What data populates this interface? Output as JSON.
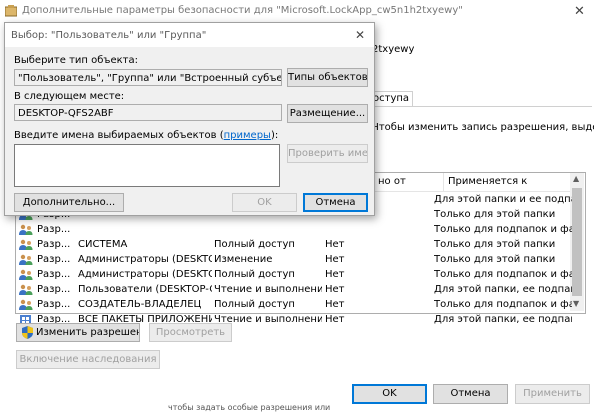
{
  "outer": {
    "title": "Дополнительные параметры безопасности  для \"Microsoft.LockApp_cw5n1h2txyewy\"",
    "bg_name_fragment": "2txyewy",
    "tab_fragment": "оступа",
    "instruction": "Чтобы изменить запись разрешения, выделите",
    "columns": {
      "inherited": "но от",
      "applies": "Применяется к"
    },
    "rows": [
      {
        "type": "Разр...",
        "principal": "",
        "access": "",
        "inherited": "",
        "applies": "Для этой папки и ее подпап..."
      },
      {
        "type": "Разр...",
        "principal": "",
        "access": "",
        "inherited": "",
        "applies": "Только для этой папки"
      },
      {
        "type": "Разр...",
        "principal": "",
        "access": "",
        "inherited": "",
        "applies": "Только для подпапок и фай..."
      },
      {
        "type": "Разр...",
        "principal": "СИСТЕМА",
        "access": "Полный доступ",
        "inherited": "Нет",
        "applies": "Только для этой папки"
      },
      {
        "type": "Разр...",
        "principal": "Администраторы (DESKTOP-...",
        "access": "Изменение",
        "inherited": "Нет",
        "applies": "Только для этой папки"
      },
      {
        "type": "Разр...",
        "principal": "Администраторы (DESKTOP-...",
        "access": "Полный доступ",
        "inherited": "Нет",
        "applies": "Только для подпапок и фай..."
      },
      {
        "type": "Разр...",
        "principal": "Пользователи (DESKTOP-QF...",
        "access": "Чтение и выполнение",
        "inherited": "Нет",
        "applies": "Для этой папки, ее подпап..."
      },
      {
        "type": "Разр...",
        "principal": "СОЗДАТЕЛЬ-ВЛАДЕЛЕЦ",
        "access": "Полный доступ",
        "inherited": "Нет",
        "applies": "Только для подпапок и фай..."
      },
      {
        "type": "Разр...",
        "principal": "ВСЕ ПАКЕТЫ ПРИЛОЖЕНИЙ",
        "access": "Чтение и выполнение",
        "inherited": "Нет",
        "applies": "Для этой папки, ее подпап..."
      }
    ],
    "buttons": {
      "change": "Изменить разрешения",
      "view": "Просмотреть",
      "inherit": "Включение наследования",
      "ok": "OK",
      "cancel": "Отмена",
      "apply": "Применить"
    },
    "bottom_fragment": "чтобы задать особые разрешения или"
  },
  "dialog": {
    "title": "Выбор: \"Пользователь\" или \"Группа\"",
    "type_label": "Выберите тип объекта:",
    "type_value": "\"Пользователь\", \"Группа\" или \"Встроенный субъект безопаснос",
    "types_button": "Типы объектов...",
    "location_label": "В следующем месте:",
    "location_value": "DESKTOP-QFS2ABF",
    "location_button": "Размещение...",
    "names_label_prefix": "Введите имена выбираемых объектов (",
    "names_label_link": "примеры",
    "names_label_suffix": "):",
    "names_value": "",
    "check_button": "Проверить имена",
    "advanced_button": "Дополнительно...",
    "ok_button": "OK",
    "cancel_button": "Отмена"
  }
}
